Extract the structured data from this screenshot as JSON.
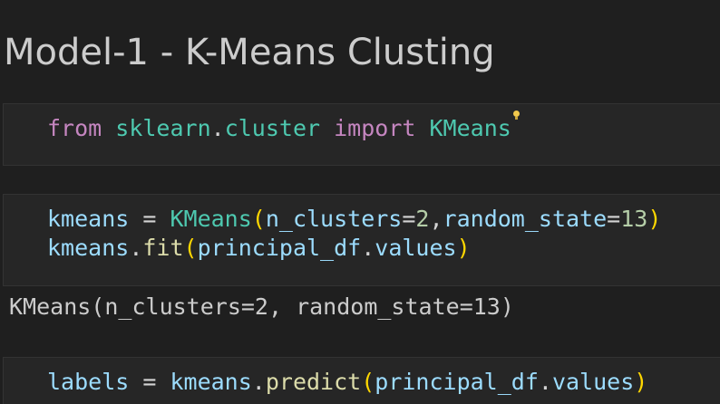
{
  "heading": "Model-1 - K-Means Clusting",
  "cell1": {
    "line1": {
      "t1": "from",
      "t2": " ",
      "t3": "sklearn",
      "t4": ".",
      "t5": "cluster",
      "t6": " ",
      "t7": "import",
      "t8": " ",
      "t9": "KMeans"
    },
    "lightbulb_icon": "lightbulb-icon"
  },
  "cell2": {
    "line1": {
      "t1": "kmeans",
      "t2": " = ",
      "t3": "KMeans",
      "t4": "(",
      "t5": "n_clusters",
      "t6": "=",
      "t7": "2",
      "t8": ",",
      "t9": "random_state",
      "t10": "=",
      "t11": "13",
      "t12": ")"
    },
    "line2": {
      "t1": "kmeans",
      "t2": ".",
      "t3": "fit",
      "t4": "(",
      "t5": "principal_df",
      "t6": ".",
      "t7": "values",
      "t8": ")"
    }
  },
  "output": "KMeans(n_clusters=2, random_state=13)",
  "cell3": {
    "line1": {
      "t1": "labels",
      "t2": " = ",
      "t3": "kmeans",
      "t4": ".",
      "t5": "predict",
      "t6": "(",
      "t7": "principal_df",
      "t8": ".",
      "t9": "values",
      "t10": ")"
    }
  },
  "colors": {
    "background": "#1f1f1f",
    "cell_background": "#262626",
    "keyword": "#c586c0",
    "class": "#4ec9b0",
    "variable": "#9cdcfe",
    "function": "#dcdcaa",
    "number": "#b5cea8",
    "bracket": "#ffd700"
  }
}
